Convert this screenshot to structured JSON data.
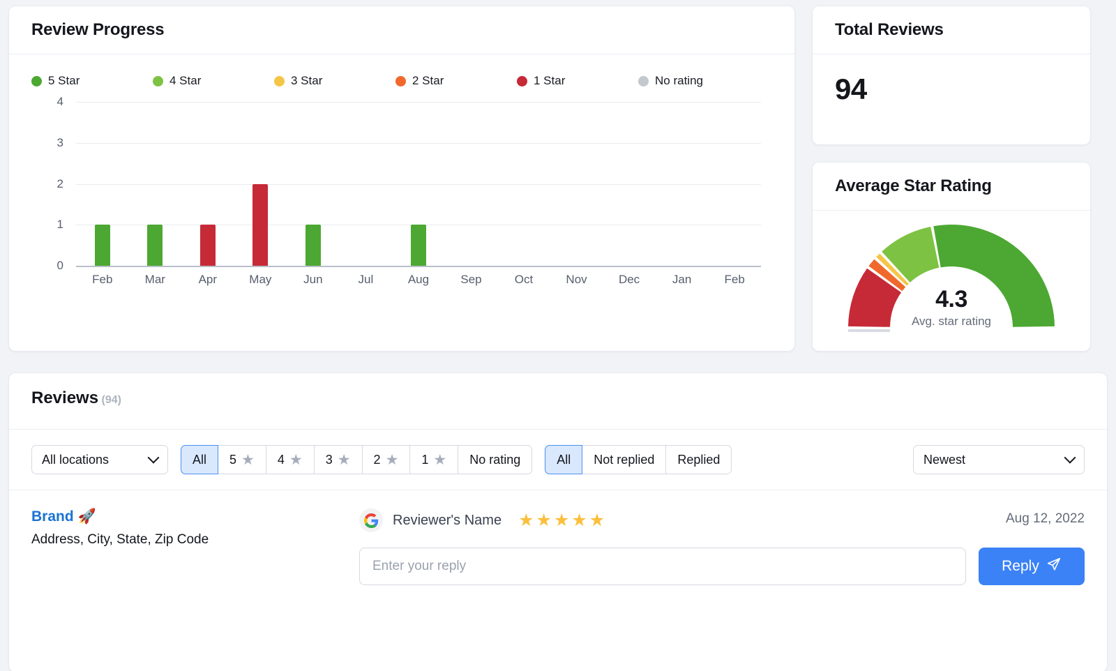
{
  "progress": {
    "title": "Review Progress",
    "legend": [
      {
        "label": "5 Star",
        "color": "#4CA832",
        "icon": "legend-dot"
      },
      {
        "label": "4 Star",
        "color": "#7DC242",
        "icon": "legend-dot"
      },
      {
        "label": "3 Star",
        "color": "#F5C547",
        "icon": "legend-dot"
      },
      {
        "label": "2 Star",
        "color": "#F0682B",
        "icon": "legend-dot"
      },
      {
        "label": "1 Star",
        "color": "#C62A37",
        "icon": "legend-dot"
      },
      {
        "label": "No rating",
        "color": "#C3C7CE",
        "icon": "legend-dot"
      }
    ]
  },
  "chart_data": {
    "type": "bar",
    "title": "Review Progress",
    "xlabel": "",
    "ylabel": "",
    "ylim": [
      0,
      4
    ],
    "yticks": [
      0,
      1,
      2,
      3,
      4
    ],
    "grid": true,
    "legend_position": "top",
    "categories": [
      "Feb",
      "Mar",
      "Apr",
      "May",
      "Jun",
      "Jul",
      "Aug",
      "Sep",
      "Oct",
      "Nov",
      "Dec",
      "Jan",
      "Feb"
    ],
    "series": [
      {
        "name": "5 Star",
        "color": "#4CA832",
        "values": [
          1,
          1,
          0,
          0,
          1,
          0,
          1,
          0,
          0,
          0,
          0,
          0,
          0
        ]
      },
      {
        "name": "4 Star",
        "color": "#7DC242",
        "values": [
          0,
          0,
          0,
          0,
          0,
          0,
          0,
          0,
          0,
          0,
          0,
          0,
          0
        ]
      },
      {
        "name": "3 Star",
        "color": "#F5C547",
        "values": [
          0,
          0,
          0,
          0,
          0,
          0,
          0,
          0,
          0,
          0,
          0,
          0,
          0
        ]
      },
      {
        "name": "2 Star",
        "color": "#F0682B",
        "values": [
          0,
          0,
          0,
          0,
          0,
          0,
          0,
          0,
          0,
          0,
          0,
          0,
          0
        ]
      },
      {
        "name": "1 Star",
        "color": "#C62A37",
        "values": [
          0,
          0,
          1,
          2,
          0,
          0,
          0,
          0,
          0,
          0,
          0,
          0,
          0
        ]
      },
      {
        "name": "No rating",
        "color": "#C3C7CE",
        "values": [
          0,
          0,
          0,
          0,
          0,
          0,
          0,
          0,
          0,
          0,
          0,
          0,
          0
        ]
      }
    ]
  },
  "total_reviews": {
    "title": "Total Reviews",
    "value": "94"
  },
  "avg_rating": {
    "title": "Average Star Rating",
    "value": "4.3",
    "caption": "Avg. star rating",
    "gauge": {
      "type": "gauge",
      "min": 0,
      "max": 5,
      "value": 4.3,
      "segments": [
        {
          "name": "1 Star",
          "color": "#C62A37",
          "span": 1
        },
        {
          "name": "2 Star",
          "color": "#F0682B",
          "span": 0.18
        },
        {
          "name": "3 Star",
          "color": "#F5C547",
          "span": 0.12
        },
        {
          "name": "4 Star",
          "color": "#7DC242",
          "span": 0.9
        },
        {
          "name": "5 Star",
          "color": "#4CA832",
          "span": 2.8
        }
      ]
    }
  },
  "reviews": {
    "title": "Reviews",
    "count": "(94)",
    "filters": {
      "location": {
        "value": "All locations",
        "icon": "chevron-down-icon"
      },
      "rating_group": [
        {
          "label": "All",
          "star": false,
          "active": true
        },
        {
          "label": "5",
          "star": true,
          "active": false
        },
        {
          "label": "4",
          "star": true,
          "active": false
        },
        {
          "label": "3",
          "star": true,
          "active": false
        },
        {
          "label": "2",
          "star": true,
          "active": false
        },
        {
          "label": "1",
          "star": true,
          "active": false
        },
        {
          "label": "No rating",
          "star": false,
          "active": false
        }
      ],
      "reply_group": [
        {
          "label": "All",
          "active": true
        },
        {
          "label": "Not replied",
          "active": false
        },
        {
          "label": "Replied",
          "active": false
        }
      ],
      "sort": {
        "value": "Newest",
        "icon": "chevron-down-icon"
      }
    },
    "items": [
      {
        "brand": "Brand 🚀",
        "address": "Address, City, State, Zip Code",
        "source_icon": "google-icon",
        "reviewer": "Reviewer's Name",
        "stars": 5,
        "date": "Aug 12, 2022",
        "reply_placeholder": "Enter your reply",
        "reply_value": "",
        "reply_button": "Reply",
        "reply_button_icon": "send-icon"
      }
    ]
  },
  "colors": {
    "page_bg": "#f1f3f7",
    "card_bg": "#ffffff",
    "accent_blue": "#3b82f6",
    "brand_link": "#1a73d4",
    "star_gold": "#fbbf3c"
  }
}
